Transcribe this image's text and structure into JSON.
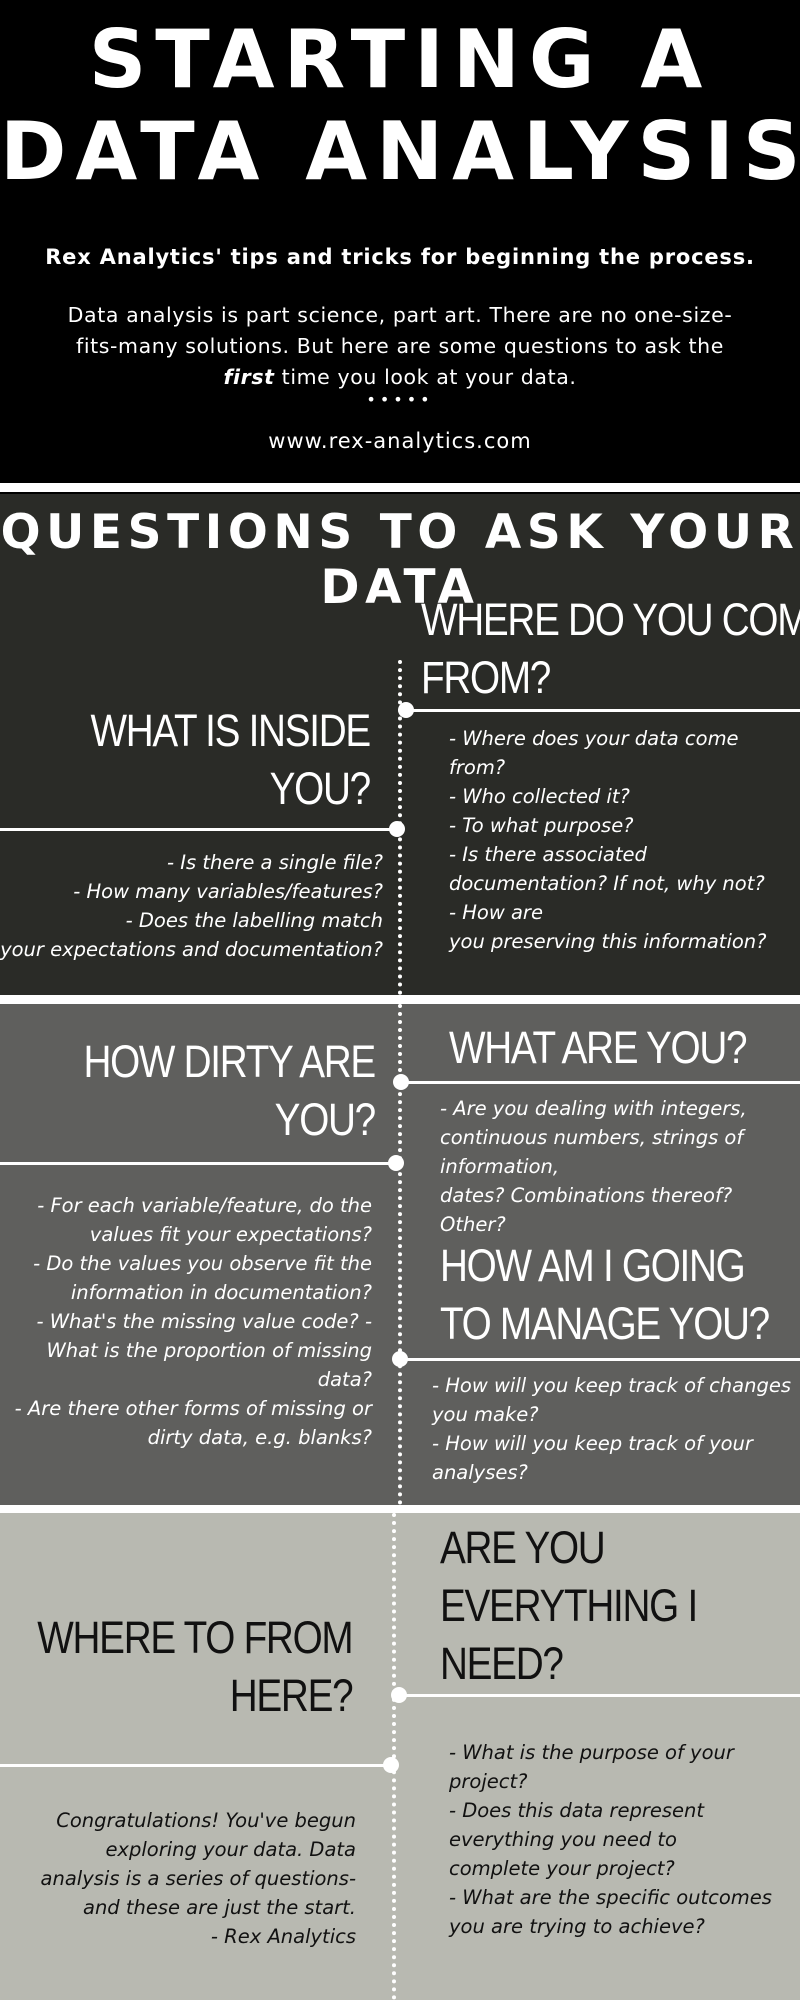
{
  "header": {
    "title_line1": "STARTING A",
    "title_line2": "DATA ANALYSIS",
    "tagline": "Rex Analytics' tips and tricks for beginning the process.",
    "intro_line1": "Data analysis is part science, part art. There are no one-size-",
    "intro_line2": "fits-many solutions. But here are some questions to ask the",
    "intro_line3_em": "first",
    "intro_line3_rest": " time you look at your data.",
    "dots": "•••••",
    "website": "www.rex-analytics.com"
  },
  "section1": {
    "title": "QUESTIONS TO ASK YOUR DATA",
    "right_heading": [
      "WHERE DO YOU COME",
      "FROM?"
    ],
    "right_items": [
      "- Where does your data come",
      "from?",
      "- Who collected it?",
      "- To what purpose?",
      "- Is there associated",
      "documentation? If not, why not?",
      "- How are",
      "you preserving this information?"
    ],
    "left_heading": [
      "WHAT IS INSIDE",
      "YOU?"
    ],
    "left_items": [
      "- Is there a single file?",
      "- How many variables/features?",
      "- Does the labelling match",
      "your expectations and documentation?"
    ]
  },
  "section2": {
    "left_heading": [
      "HOW DIRTY ARE",
      "YOU?"
    ],
    "left_items": [
      "- For each variable/feature, do the",
      "values fit your expectations?",
      "- Do the values you observe fit the",
      "information in documentation?",
      "- What's the missing value code? -",
      "What is the proportion of missing",
      "data?",
      "- Are there other forms of missing or",
      "dirty data, e.g. blanks?"
    ],
    "right_heading": [
      "WHAT ARE YOU?"
    ],
    "right_items": [
      "- Are you dealing with integers,",
      "continuous numbers, strings of",
      "information,",
      "dates? Combinations thereof?",
      "Other?"
    ],
    "right_heading2": [
      "HOW AM I GOING",
      "TO MANAGE YOU?"
    ],
    "right_items2": [
      "- How will you keep track of changes",
      "you make?",
      "- How will you keep track of your",
      "analyses?"
    ]
  },
  "section3": {
    "right_heading": [
      "ARE YOU",
      "EVERYTHING I",
      "NEED?"
    ],
    "right_items": [
      "- What is the purpose of your",
      "project?",
      "- Does this data represent",
      "everything you need to",
      "complete your project?",
      "- What are the specific outcomes",
      "you are trying to achieve?"
    ],
    "left_heading": [
      "WHERE TO FROM",
      "HERE?"
    ],
    "left_items": [
      "Congratulations! You've begun",
      "exploring your data. Data",
      "analysis is a series of questions-",
      "and these are just the start.",
      "- Rex Analytics"
    ]
  },
  "colors": {
    "header_bg": "#000000",
    "section1_bg": "#2a2b27",
    "section2_bg": "#5f5f5d",
    "section3_bg": "#b8b9b1",
    "text_light": "#ffffff",
    "text_dark": "#111111"
  }
}
